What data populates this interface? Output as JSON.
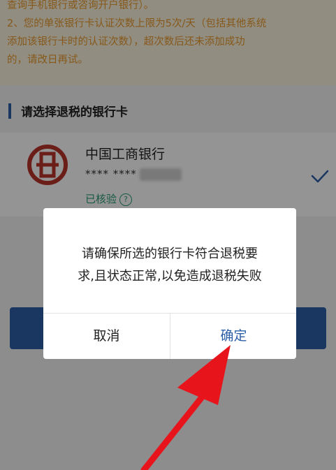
{
  "notice": {
    "line1": "查询手机银行或咨询开户银行）。",
    "line2": "2、您的单张银行卡认证次数上限为5次/天（包括其他系统",
    "line3": "添加该银行卡时的认证次数），超次数后还未添加成功",
    "line4": "的，请改日再试。"
  },
  "section": {
    "title": "请选择退税的银行卡"
  },
  "card": {
    "bank_name": "中国工商银行",
    "number_masked": "**** ****",
    "status": "已核验",
    "help": "?"
  },
  "dialog": {
    "message_line1": "请确保所选的银行卡符合退税要",
    "message_line2": "求,且状态正常,以免造成退税失败",
    "cancel_label": "取消",
    "confirm_label": "确定"
  },
  "colors": {
    "accent": "#2d5fa8",
    "notice_text": "#e79a2e",
    "verified": "#2a9b78",
    "arrow": "#e8141c"
  }
}
